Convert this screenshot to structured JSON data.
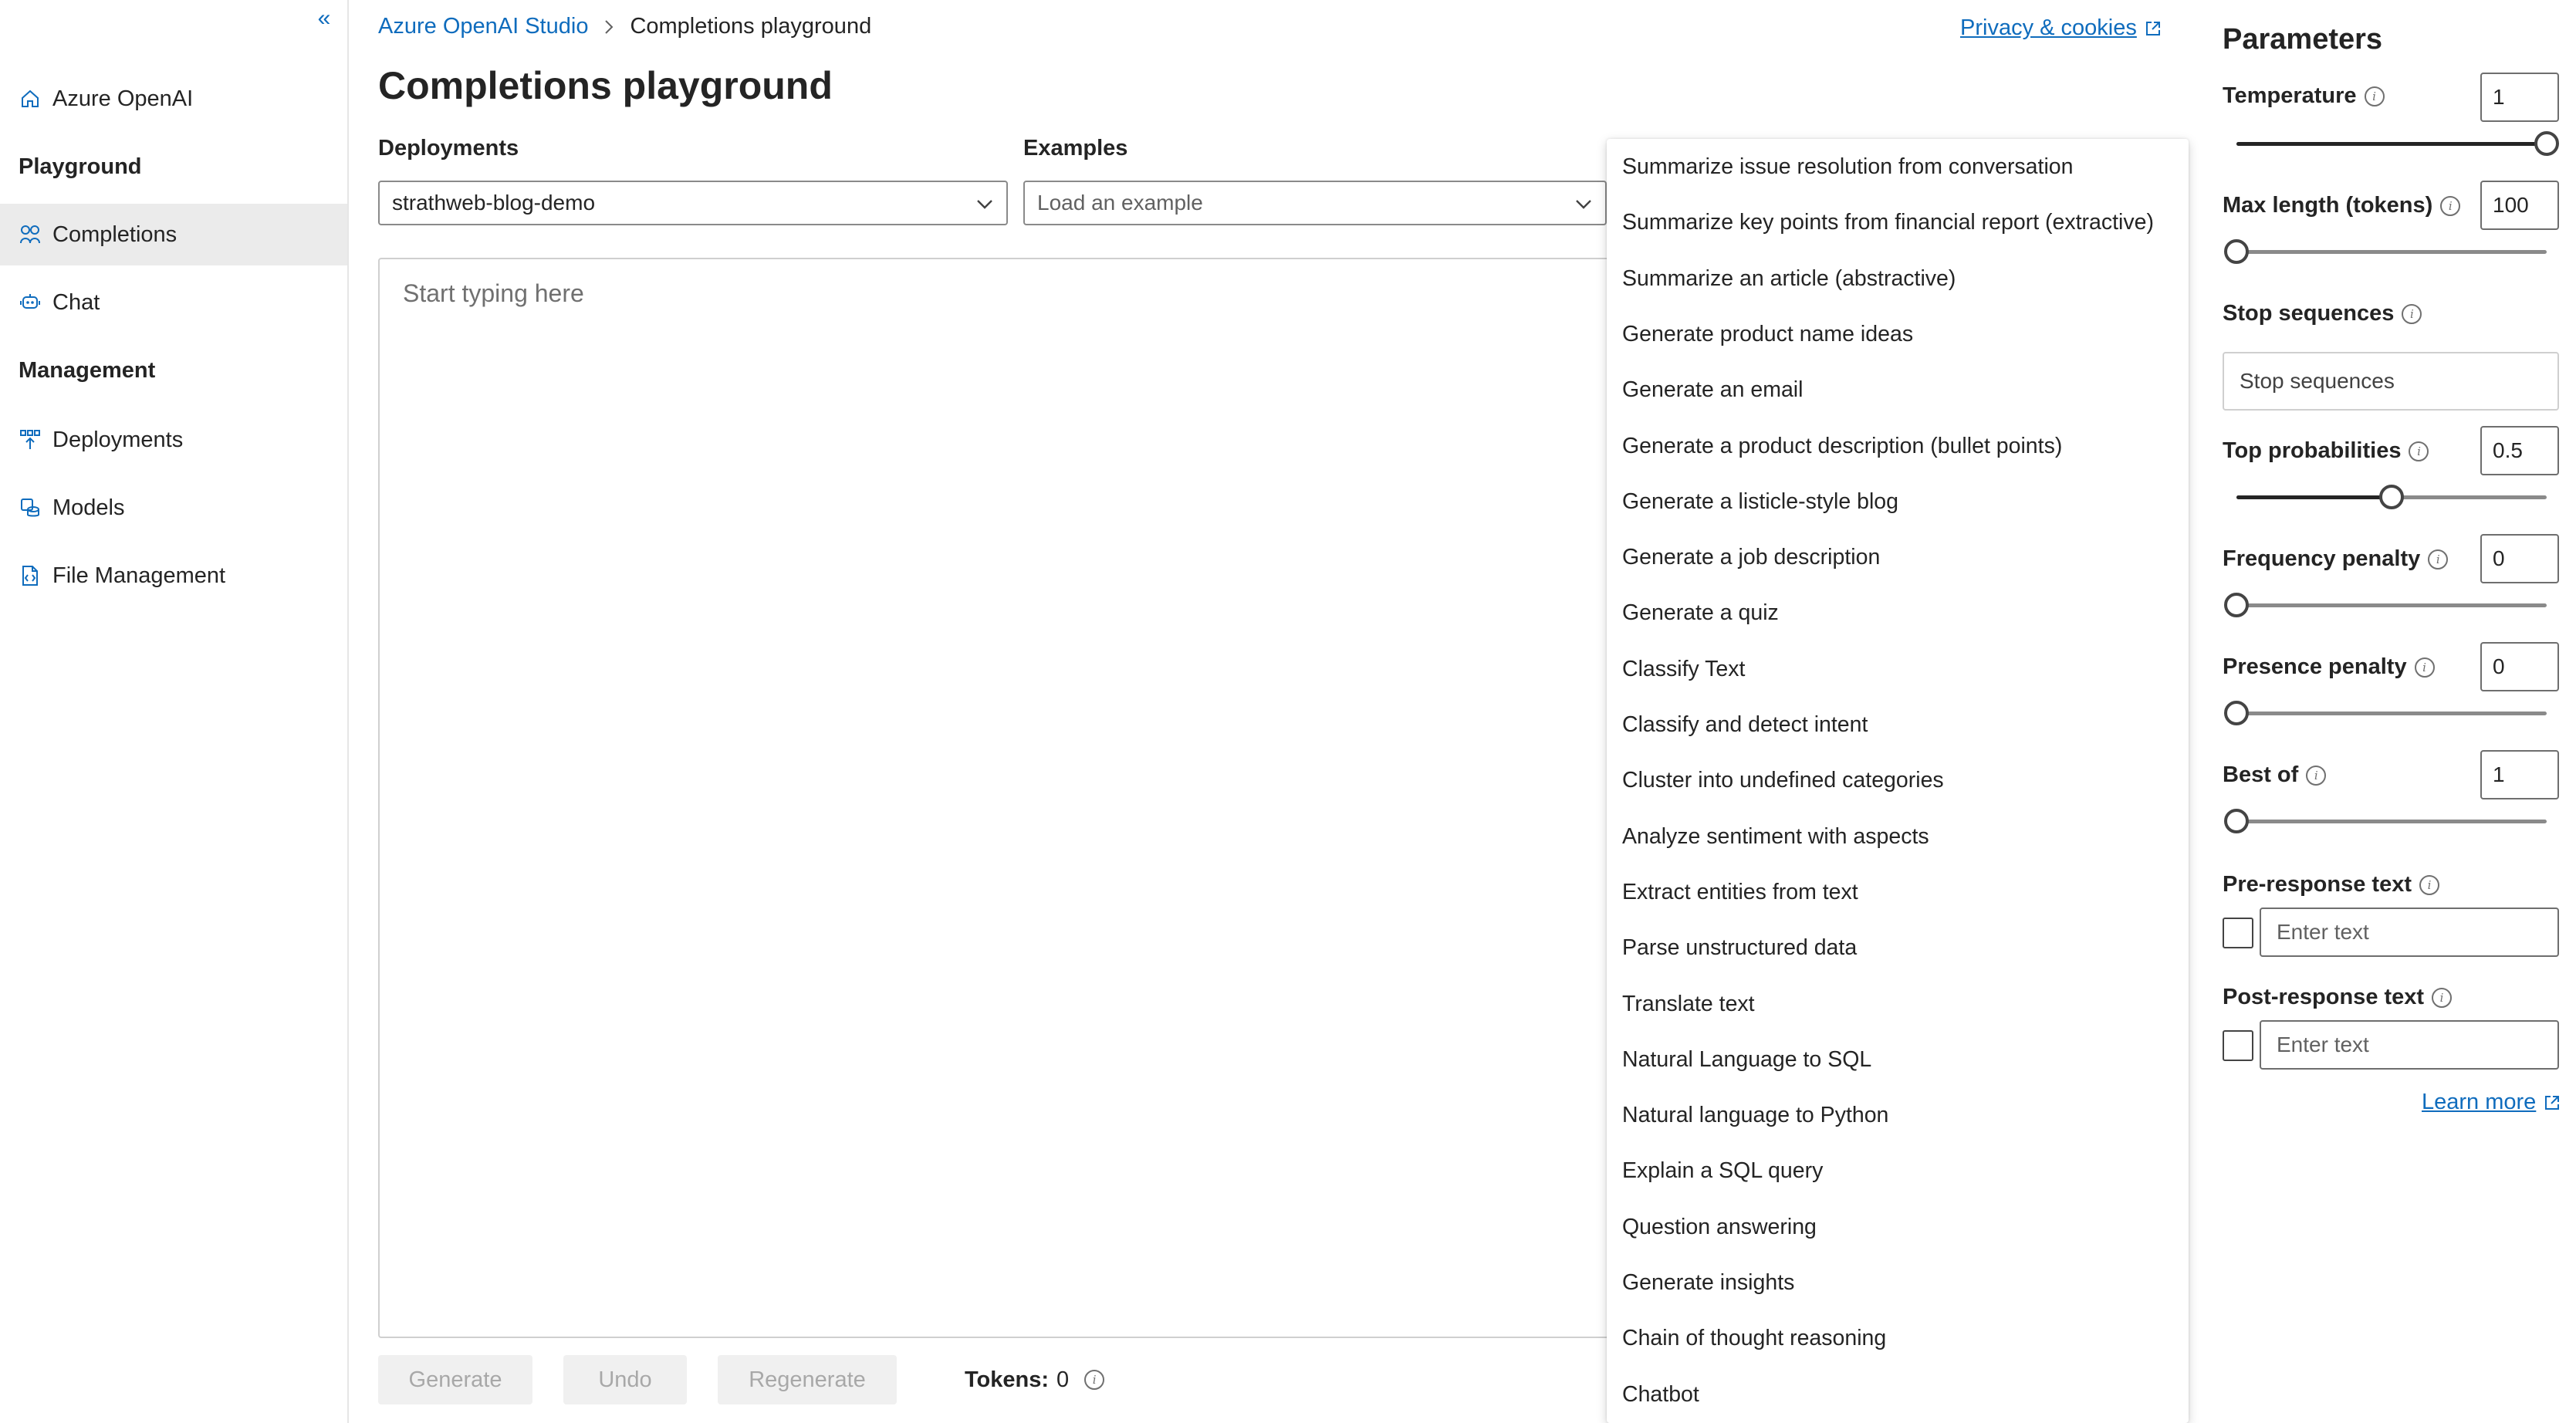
{
  "sidebar": {
    "home_label": "Azure OpenAI",
    "playground_heading": "Playground",
    "completions_label": "Completions",
    "chat_label": "Chat",
    "management_heading": "Management",
    "deployments_label": "Deployments",
    "models_label": "Models",
    "file_management_label": "File Management"
  },
  "breadcrumb": {
    "root": "Azure OpenAI Studio",
    "current": "Completions playground"
  },
  "header": {
    "privacy_link": "Privacy & cookies",
    "page_title": "Completions playground"
  },
  "deployments": {
    "label": "Deployments",
    "selected": "strathweb-blog-demo"
  },
  "examples": {
    "label": "Examples",
    "placeholder": "Load an example",
    "items": [
      "Summarize issue resolution from conversation",
      "Summarize key points from financial report (extractive)",
      "Summarize an article (abstractive)",
      "Generate product name ideas",
      "Generate an email",
      "Generate a product description (bullet points)",
      "Generate a listicle-style blog",
      "Generate a job description",
      "Generate a quiz",
      "Classify Text",
      "Classify and detect intent",
      "Cluster into undefined categories",
      "Analyze sentiment with aspects",
      "Extract entities from text",
      "Parse unstructured data",
      "Translate text",
      "Natural Language to SQL",
      "Natural language to Python",
      "Explain a SQL query",
      "Question answering",
      "Generate insights",
      "Chain of thought reasoning",
      "Chatbot"
    ]
  },
  "editor": {
    "placeholder": "Start typing here"
  },
  "actions": {
    "generate": "Generate",
    "undo": "Undo",
    "regenerate": "Regenerate",
    "tokens_label": "Tokens:",
    "tokens_value": "0"
  },
  "parameters": {
    "title": "Parameters",
    "temperature": {
      "label": "Temperature",
      "value": "1",
      "level": 1.0
    },
    "max_length": {
      "label": "Max length (tokens)",
      "value": "100",
      "level": 0.0
    },
    "stop_sequences": {
      "label": "Stop sequences",
      "placeholder": "Stop sequences"
    },
    "top_probabilities": {
      "label": "Top probabilities",
      "value": "0.5",
      "level": 0.5
    },
    "frequency_penalty": {
      "label": "Frequency penalty",
      "value": "0",
      "level": 0.0
    },
    "presence_penalty": {
      "label": "Presence penalty",
      "value": "0",
      "level": 0.0
    },
    "best_of": {
      "label": "Best of",
      "value": "1",
      "level": 0.0
    },
    "pre_response": {
      "label": "Pre-response text",
      "placeholder": "Enter text"
    },
    "post_response": {
      "label": "Post-response text",
      "placeholder": "Enter text"
    },
    "learn_more": "Learn more"
  },
  "colors": {
    "accent": "#0f6cbd",
    "active_nav": "#ebebeb",
    "disabled_bg": "#f0f0f0"
  }
}
